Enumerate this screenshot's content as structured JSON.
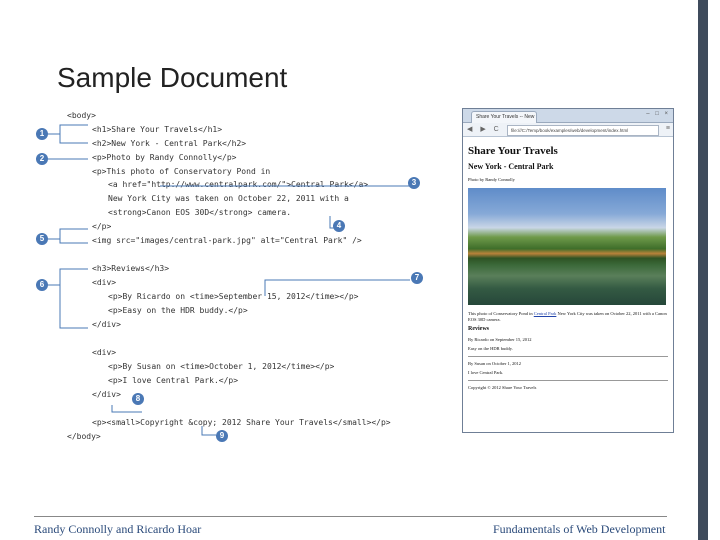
{
  "slide": {
    "title": "Sample Document"
  },
  "code_lines": [
    "<body>",
    "<h1>Share Your Travels</h1>",
    "<h2>New York - Central Park</h2>",
    "<p>Photo by Randy Connolly</p>",
    "<p>This photo of Conservatory Pond in",
    "<a href=\"http://www.centralpark.com/\">Central Park</a>",
    "New York City was taken on October 22, 2011 with a",
    "<strong>Canon EOS 30D</strong> camera.",
    "</p>",
    "<img src=\"images/central-park.jpg\" alt=\"Central Park\" />",
    "<h3>Reviews</h3>",
    "<div>",
    "<p>By Ricardo on <time>September 15, 2012</time></p>",
    "<p>Easy on the HDR buddy.</p>",
    "</div>",
    "<div>",
    "<p>By Susan on <time>October 1, 2012</time></p>",
    "<p>I love Central Park.</p>",
    "</div>",
    "<p><small>Copyright &copy; 2012 Share Your Travels</small></p>",
    "</body>"
  ],
  "markers": [
    "1",
    "2",
    "3",
    "4",
    "5",
    "6",
    "7",
    "8",
    "9"
  ],
  "browser": {
    "tab_label": "Share Your Travels -- New",
    "window_controls": "– □ ×",
    "nav_icons": "◀ ▶ C ⌂",
    "url": "file:///C:/Temp/book/examples/web/development/index.html",
    "wrench_icon": "≡",
    "h1": "Share Your Travels",
    "h2": "New York - Central Park",
    "photo_credit": "Photo by Randy Connolly",
    "desc_before": "This photo of Conservatory Pond in ",
    "desc_link": "Central Park",
    "desc_after": " New York City was taken on October 22, 2011 with a Canon EOS 30D camera.",
    "reviews_heading": "Reviews",
    "review1_by": "By Ricardo on September 15, 2012",
    "review1_text": "Easy on the HDR buddy.",
    "review2_by": "By Susan on October 1, 2012",
    "review2_text": "I love Central Park.",
    "copyright": "Copyright © 2012 Share Your Travels"
  },
  "footer": {
    "left": "Randy Connolly and Ricardo Hoar",
    "right": "Fundamentals of Web Development"
  },
  "colors": {
    "accent": "#4a78b5",
    "side_bar": "#3f4b5c",
    "footer_text": "#2a4a7a"
  }
}
